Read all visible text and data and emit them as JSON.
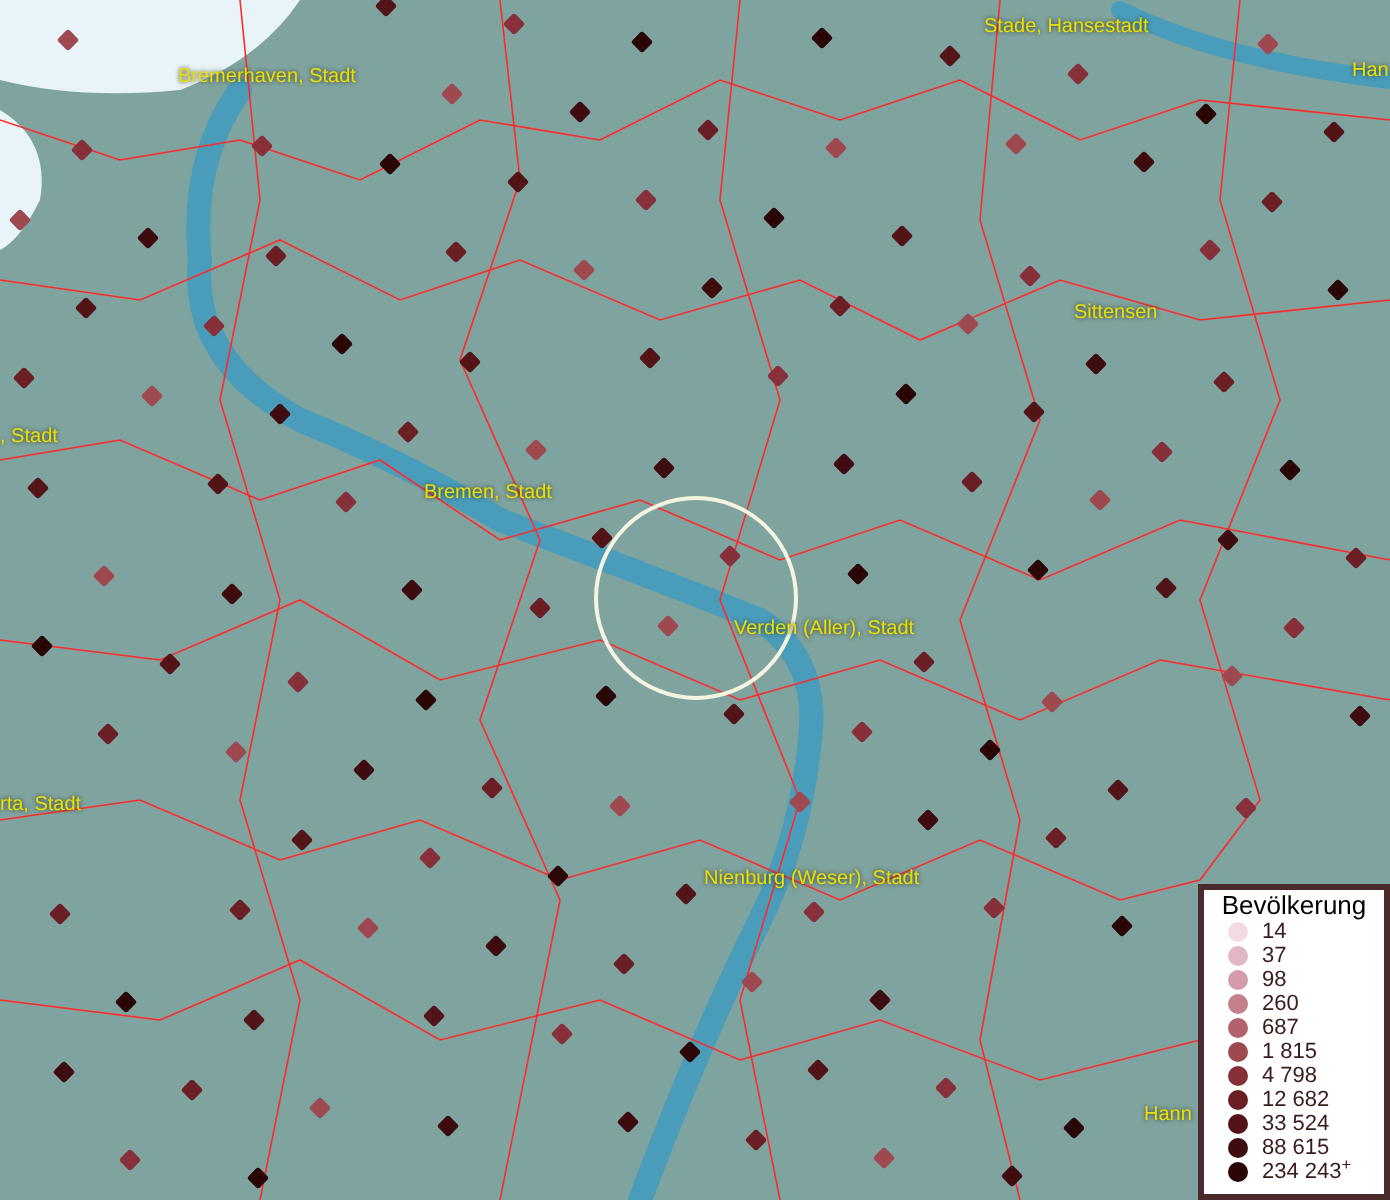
{
  "map": {
    "place_labels": [
      {
        "text": "Bremerhaven, Stadt"
      },
      {
        "text": "Stade, Hansestadt"
      },
      {
        "text": "Han"
      },
      {
        "text": "Sittensen"
      },
      {
        "text": ", Stadt"
      },
      {
        "text": "Bremen, Stadt"
      },
      {
        "text": "Verden (Aller), Stadt"
      },
      {
        "text": "rta, Stadt"
      },
      {
        "text": "Nienburg (Weser), Stadt"
      },
      {
        "text": "Hann"
      }
    ]
  },
  "legend": {
    "title": "Bevölkerung",
    "items": [
      {
        "label": "14",
        "color": "#f3dbe6"
      },
      {
        "label": "37",
        "color": "#e2b6c2"
      },
      {
        "label": "98",
        "color": "#d39ca8"
      },
      {
        "label": "260",
        "color": "#c2818b"
      },
      {
        "label": "687",
        "color": "#b1626a"
      },
      {
        "label": "1 815",
        "color": "#9e4850"
      },
      {
        "label": "4 798",
        "color": "#87303a"
      },
      {
        "label": "12 682",
        "color": "#6c1e25"
      },
      {
        "label": "33 524",
        "color": "#531418"
      },
      {
        "label": "88 615",
        "color": "#3e0b0e"
      },
      {
        "label": "234 243$^{+}$",
        "color": "#2a0606"
      }
    ]
  }
}
